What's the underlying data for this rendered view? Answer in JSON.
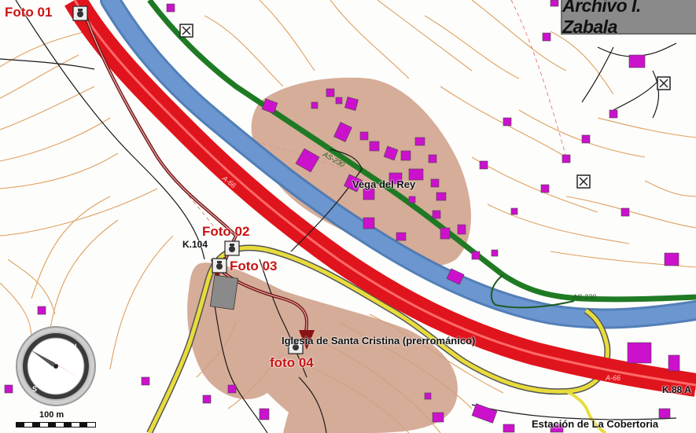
{
  "archive_label": "Archivo I. Zabala",
  "photo_labels": {
    "foto01": "Foto 01",
    "foto02": "Foto 02",
    "foto03": "Foto 03",
    "foto04": "foto 04"
  },
  "places": {
    "vega_del_rey": "Vega del Rey",
    "iglesia": "Iglesia de Santa Cristina (prerrománico)",
    "estacion": "Estación de La Cobertoria"
  },
  "road_labels": {
    "km104": "K.104",
    "km88": "K.88 A",
    "as230": "AS-230",
    "a66_left": "A-66",
    "a66_right": "A-66"
  },
  "scale_text": "100 m",
  "compass_letters": {
    "north": "N",
    "south": "S"
  },
  "colors": {
    "highway": "#e0141c",
    "river": "#5a88c4",
    "green_road": "#1f7a24",
    "yellow_road": "#e8dc3c",
    "settlement": "#cf9f87",
    "building": "#cc11cc",
    "contour": "#d88a3a",
    "path": "#6a1212",
    "label_red": "#c81414"
  },
  "icons": [
    "camera-icon",
    "landmark-box-icon",
    "compass-icon",
    "scale-bar"
  ]
}
